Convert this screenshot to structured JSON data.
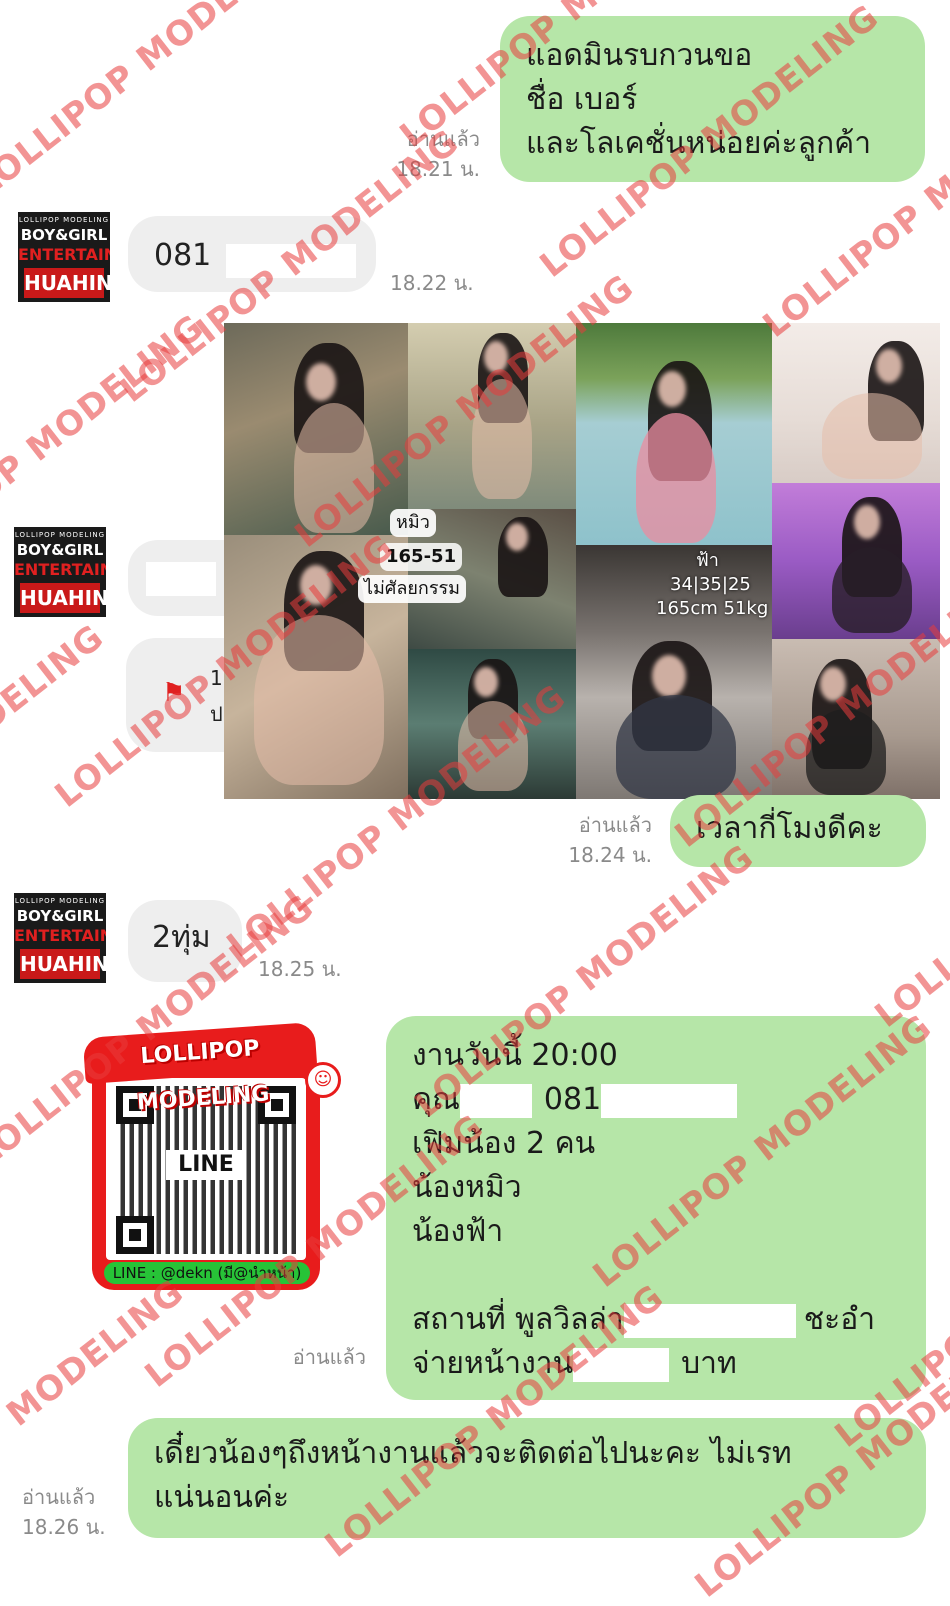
{
  "messages": {
    "m1": {
      "lines": [
        "แอดมินรบกวนขอ",
        "ชื่อ เบอร์",
        "และโลเคชั่นหน่อยค่ะลูกค้า"
      ],
      "read": "อ่านแล้ว",
      "time": "18.21 น."
    },
    "m2": {
      "text": "081",
      "time": "18.22 น."
    },
    "m3": {
      "text": "1",
      "text2": "ป"
    },
    "collage": {
      "left_tag1": "หมิว",
      "left_tag2": "165-51",
      "left_tag3": "ไม่ศัลยกรรม",
      "right_name": "ฟ้า",
      "right_stats": "34|35|25",
      "right_size": "165cm 51kg"
    },
    "m4": {
      "text": "เวลากี่โมงดีคะ",
      "read": "อ่านแล้ว",
      "time": "18.24 น."
    },
    "m5": {
      "text": "2ทุ่ม",
      "time": "18.25 น."
    },
    "m6": {
      "lines": [
        "งานวันนี้ 20:00",
        "คุณ",
        "081",
        "เฟิมน้อง 2 คน",
        "น้องหมิว",
        "น้องฟ้า",
        "สถานที่ พูลวิลล่า",
        "ชะอำ",
        "จ่ายหน้างาน",
        "บาท"
      ],
      "read": "อ่านแล้ว"
    },
    "m7": {
      "line1": "เดี๋ยวน้องๆถึงหน้างานแล้วจะติดต่อไปนะคะ ไม่เรท",
      "line2": "แน่นอนค่ะ",
      "read": "อ่านแล้ว",
      "time": "18.26 น."
    }
  },
  "avatar": {
    "small": "LOLLIPOP MODELING",
    "line1": "BOY&GIRL",
    "line2": "ENTERTAIN",
    "line3": "HUAHIN"
  },
  "qr": {
    "banner": "LOLLIPOP MODELING",
    "center": "LINE",
    "id_label": "LINE : @dekn (มี@นำหน้า)"
  },
  "watermark": "LOLLIPOP MODELING",
  "colors": {
    "outgoing_bubble": "#b6e6a8",
    "incoming_bubble": "#eeeeee",
    "watermark": "#e83c3c",
    "qr_red": "#e81c1c"
  }
}
